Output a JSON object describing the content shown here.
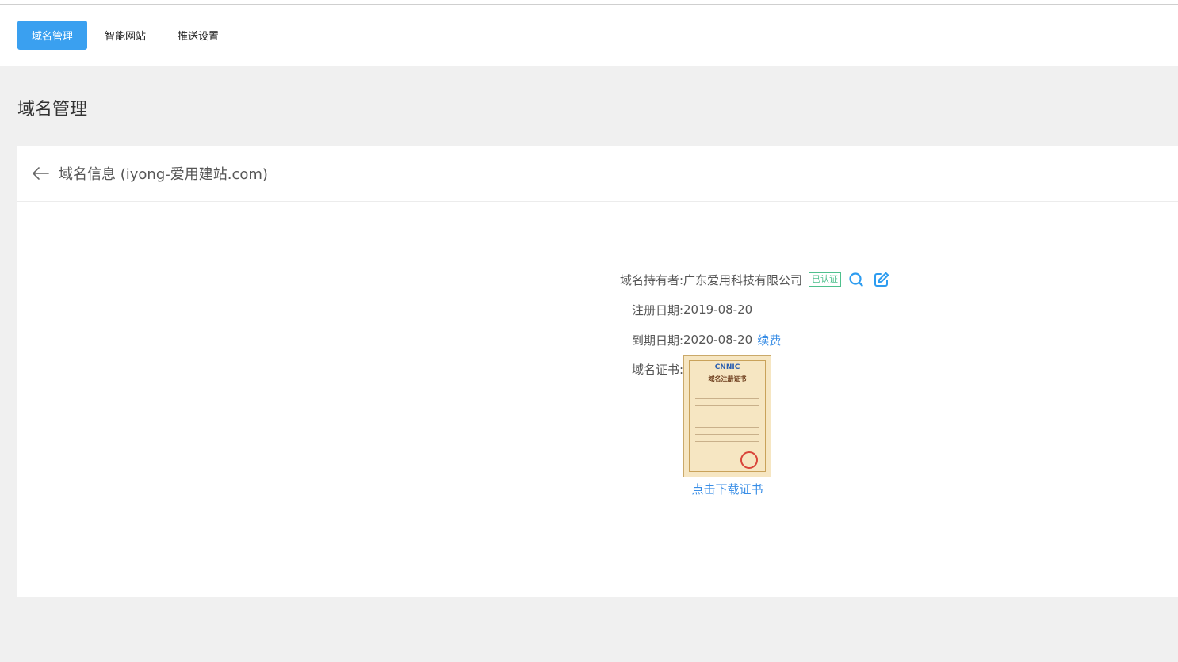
{
  "tabs": [
    {
      "label": "域名管理",
      "active": true
    },
    {
      "label": "智能网站",
      "active": false
    },
    {
      "label": "推送设置",
      "active": false
    }
  ],
  "page_title": "域名管理",
  "card": {
    "title": "域名信息 (iyong-爱用建站.com)"
  },
  "info": {
    "holder_label": "域名持有者:",
    "holder_value": "广东爱用科技有限公司",
    "holder_badge": "已认证",
    "reg_label": "注册日期:",
    "reg_value": "2019-08-20",
    "exp_label": "到期日期:",
    "exp_value": "2020-08-20",
    "renew_link": "续费",
    "cert_label": "域名证书:",
    "cert_logo": "CNNIC",
    "cert_title": "域名注册证书",
    "cert_download": "点击下载证书"
  },
  "colors": {
    "accent": "#3aa0f0",
    "link": "#3a8ee6",
    "badge": "#4fc08d"
  }
}
